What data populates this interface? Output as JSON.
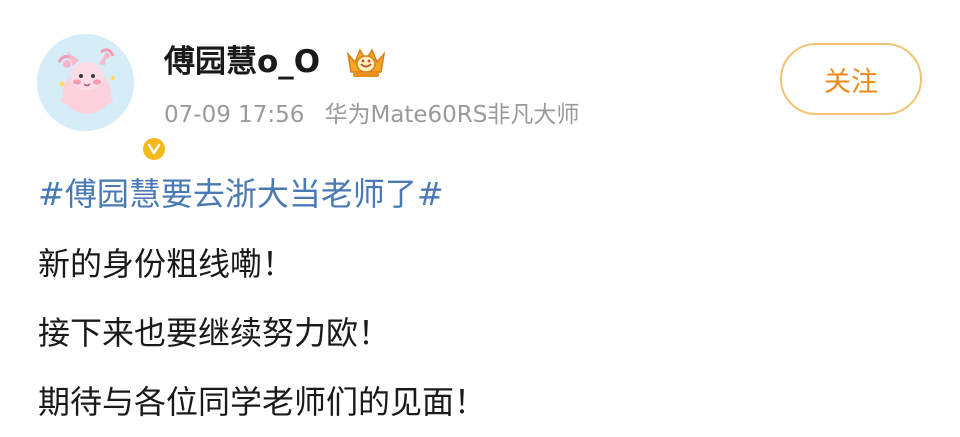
{
  "author": {
    "name": "傅园慧o_O",
    "avatar_icon": "pink-cartoon-avatar-icon",
    "badge_icon": "verified-v-icon",
    "level_icon": "crown-medal-icon"
  },
  "meta": {
    "time": "07-09 17:56",
    "device": "华为Mate60RS非凡大师"
  },
  "follow_button": {
    "label": "关注"
  },
  "post": {
    "hashtag": "#傅园慧要去浙大当老师了#",
    "lines": [
      "新的身份粗线嘞！",
      "接下来也要继续努力欧！",
      "期待与各位同学老师们的见面！"
    ]
  },
  "colors": {
    "hashtag": "#4a7ab3",
    "follow_text": "#ee8a1a",
    "follow_border": "#f3c374",
    "meta": "#9a9a9a",
    "badge": "#f6b91c"
  }
}
